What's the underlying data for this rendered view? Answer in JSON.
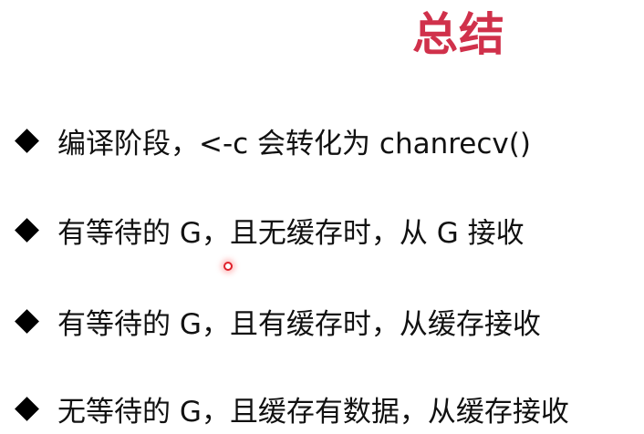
{
  "slide": {
    "title": "总结",
    "title_color": "#d0314b",
    "bullets": [
      {
        "icon": "diamond-bullet",
        "text": "编译阶段，<-c 会转化为 chanrecv()"
      },
      {
        "icon": "diamond-bullet",
        "text": "有等待的 G，且无缓存时，从 G 接收"
      },
      {
        "icon": "diamond-bullet",
        "text": "有等待的 G，且有缓存时，从缓存接收"
      },
      {
        "icon": "diamond-bullet",
        "text": "无等待的 G，且缓存有数据，从缓存接收"
      }
    ]
  }
}
